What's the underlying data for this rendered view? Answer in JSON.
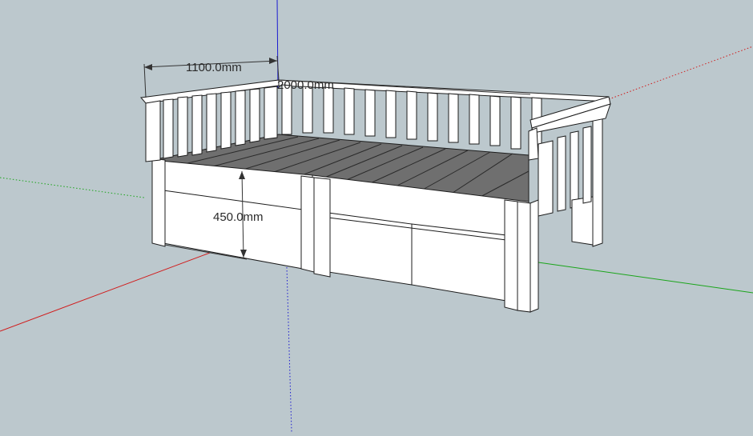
{
  "viewport": {
    "background": "#bcc8cd"
  },
  "axes": {
    "red": "#d11a1a",
    "green": "#1aa51a",
    "blue": "#1a1ad1"
  },
  "dimensions": {
    "width_label": "1100.0mm",
    "length_label": "2000.0mm",
    "height_label": "450.0mm"
  },
  "model": {
    "face_color": "#ffffff",
    "deck_color": "#6f6f6f",
    "edge_color": "#1c1c1c"
  }
}
